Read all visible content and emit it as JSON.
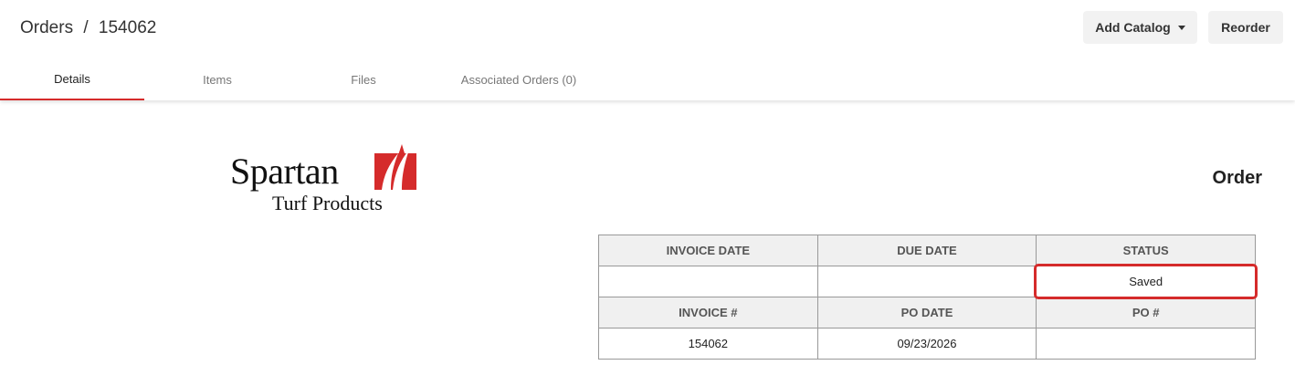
{
  "header": {
    "breadcrumb_section": "Orders",
    "breadcrumb_separator": "/",
    "breadcrumb_id": "154062",
    "add_catalog_label": "Add Catalog",
    "reorder_label": "Reorder"
  },
  "tabs": [
    {
      "label": "Details",
      "active": true
    },
    {
      "label": "Items",
      "active": false
    },
    {
      "label": "Files",
      "active": false
    },
    {
      "label": "Associated Orders (0)",
      "active": false
    }
  ],
  "logo": {
    "name": "Spartan",
    "sub": "Turf Products",
    "icon": "spartan-grass-logo-icon"
  },
  "document": {
    "title": "Order",
    "headers_row1": [
      "INVOICE DATE",
      "DUE DATE",
      "STATUS"
    ],
    "values_row1": [
      "",
      "",
      "Saved"
    ],
    "headers_row2": [
      "INVOICE #",
      "PO DATE",
      "PO #"
    ],
    "values_row2": [
      "154062",
      "09/23/2026",
      ""
    ]
  },
  "colors": {
    "accent": "#d52b2b",
    "header_cell_bg": "#f0f0f0",
    "button_bg": "#f2f2f2"
  }
}
